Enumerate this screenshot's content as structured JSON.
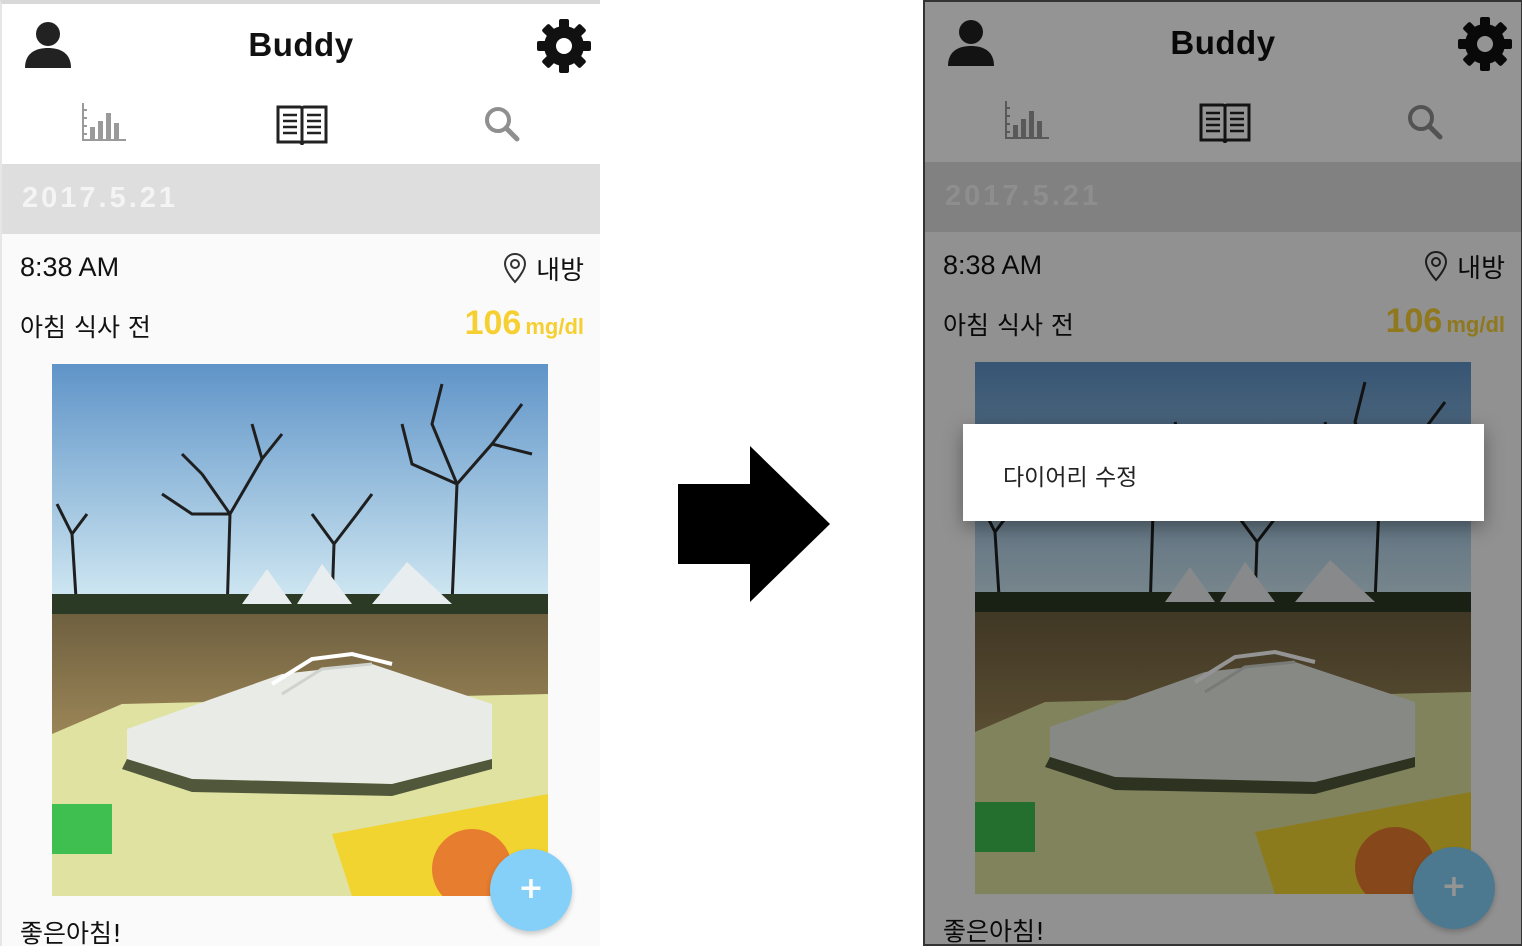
{
  "screens": [
    {
      "appbar": {
        "title": "Buddy",
        "left_icon": "person-icon",
        "right_icon": "gear-icon"
      },
      "tabs": [
        {
          "icon": "bar-chart-icon"
        },
        {
          "icon": "book-icon",
          "selected": true
        },
        {
          "icon": "search-icon"
        }
      ],
      "date": "2017.5.21",
      "entry": {
        "time": "8:38 AM",
        "location": "내방",
        "meal": "아침 식사 전",
        "glucose_value": "106",
        "glucose_unit": "mg/dl",
        "memo": "좋은아침!"
      },
      "fab_label": "+"
    },
    {
      "appbar": {
        "title": "Buddy",
        "left_icon": "person-icon",
        "right_icon": "gear-icon"
      },
      "tabs": [
        {
          "icon": "bar-chart-icon"
        },
        {
          "icon": "book-icon",
          "selected": true
        },
        {
          "icon": "search-icon"
        }
      ],
      "date": "2017.5.21",
      "entry": {
        "time": "8:38 AM",
        "location": "내방",
        "meal": "아침 식사 전",
        "glucose_value": "106",
        "glucose_unit": "mg/dl",
        "memo": "좋은아침!"
      },
      "fab_label": "+",
      "context_menu": {
        "items": [
          "다이어리 수정"
        ]
      }
    }
  ],
  "transition_icon": "right-arrow-icon",
  "colors": {
    "glucose": "#f6cf33",
    "fab": "#84d0f8",
    "date_band": "#dedede"
  }
}
